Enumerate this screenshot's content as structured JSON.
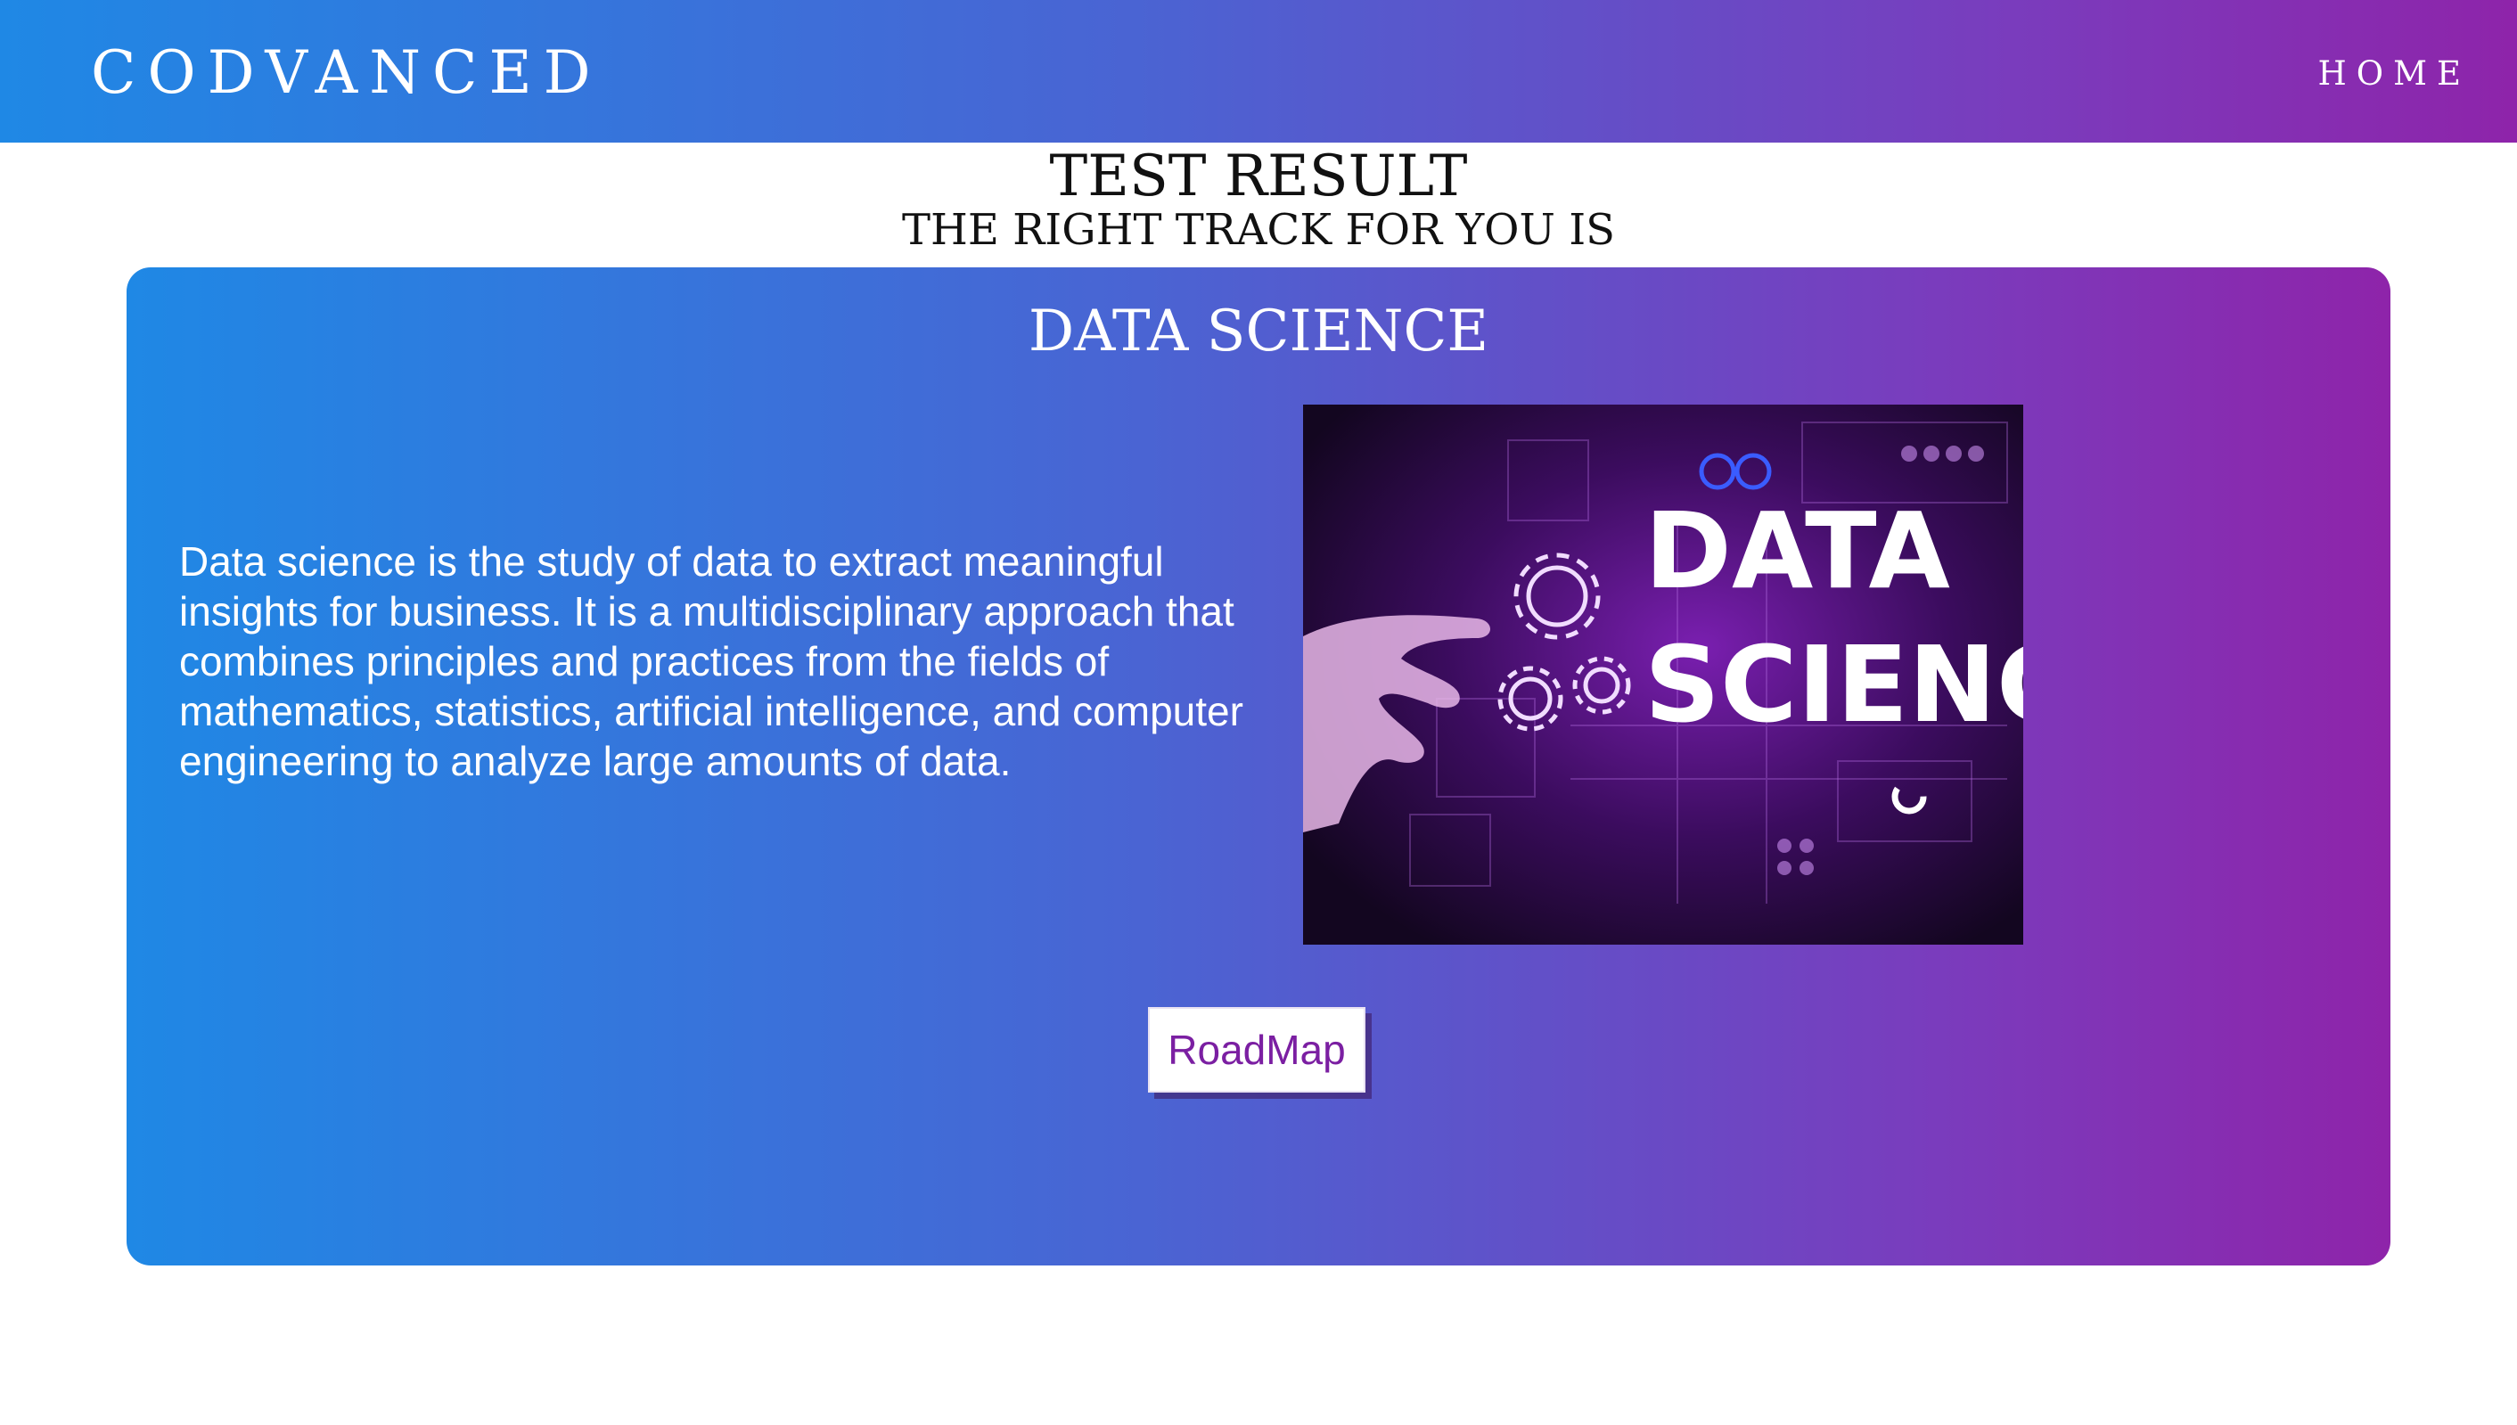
{
  "navbar": {
    "brand": "CODVANCED",
    "home_link": "HOME"
  },
  "result": {
    "title": "TEST RESULT",
    "subtitle": "THE RIGHT TRACK FOR YOU IS",
    "track_name": "DATA SCIENCE",
    "description": "Data science is the study of data to extract meaningful insights for business. It is a multidisciplinary approach that combines principles and practices from the fields of mathematics, statistics, artificial intelligence, and computer engineering to analyze large amounts of data.",
    "image_text_line1": "DATA",
    "image_text_line2": "SCIENCE",
    "roadmap_button": "RoadMap"
  }
}
